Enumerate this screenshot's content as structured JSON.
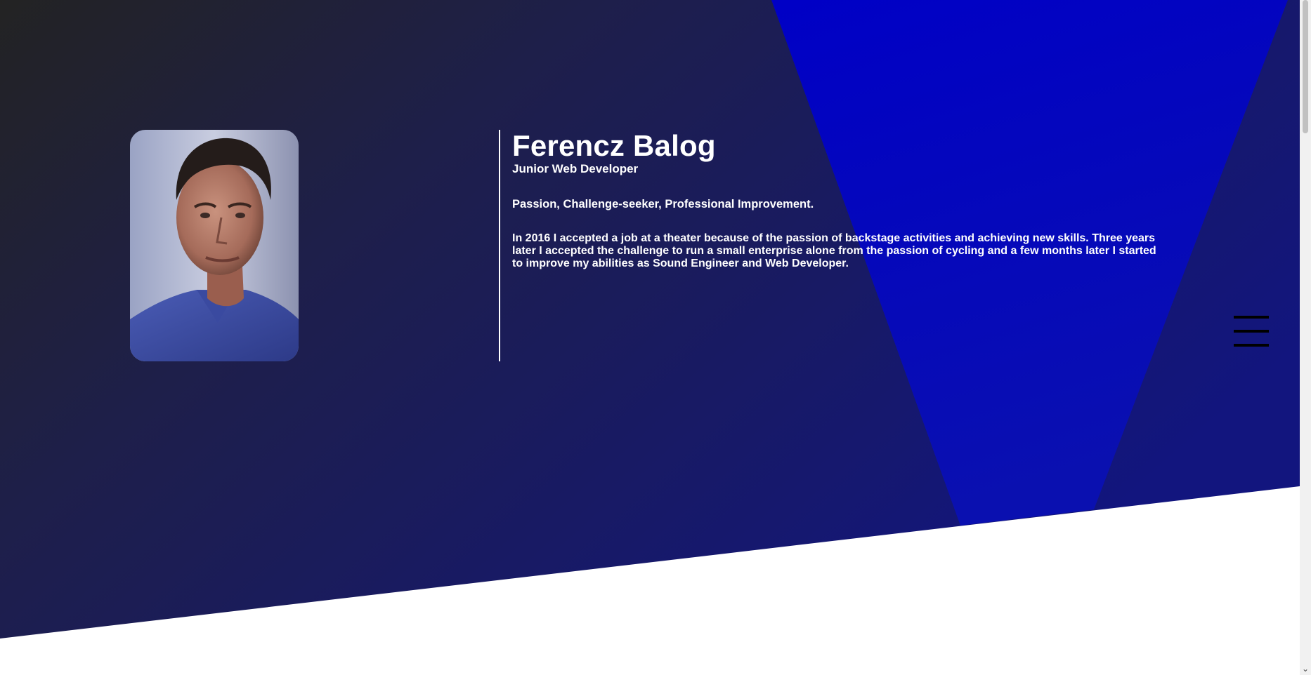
{
  "profile": {
    "name": "Ferencz Balog",
    "role": "Junior Web Developer",
    "tagline": "Passion, Challenge-seeker, Professional Improvement.",
    "bio": "In 2016 I accepted a job at a theater because of the passion of backstage activities and achieving new skills. Three years later I accepted the challenge to run a small enterprise alone from the passion of cycling and a few months later I started to improve my abilities as Sound Engineer and Web Developer."
  },
  "icons": {
    "menu": "hamburger-menu-icon",
    "scroll_down": "chevron-down-icon"
  },
  "scrollbar": {
    "down_glyph": "⌄"
  },
  "colors": {
    "hero_dark": "#232323",
    "hero_navy": "#15177a",
    "accent_blue": "#0000c4",
    "text": "#ffffff",
    "menu_bars": "#000000"
  }
}
